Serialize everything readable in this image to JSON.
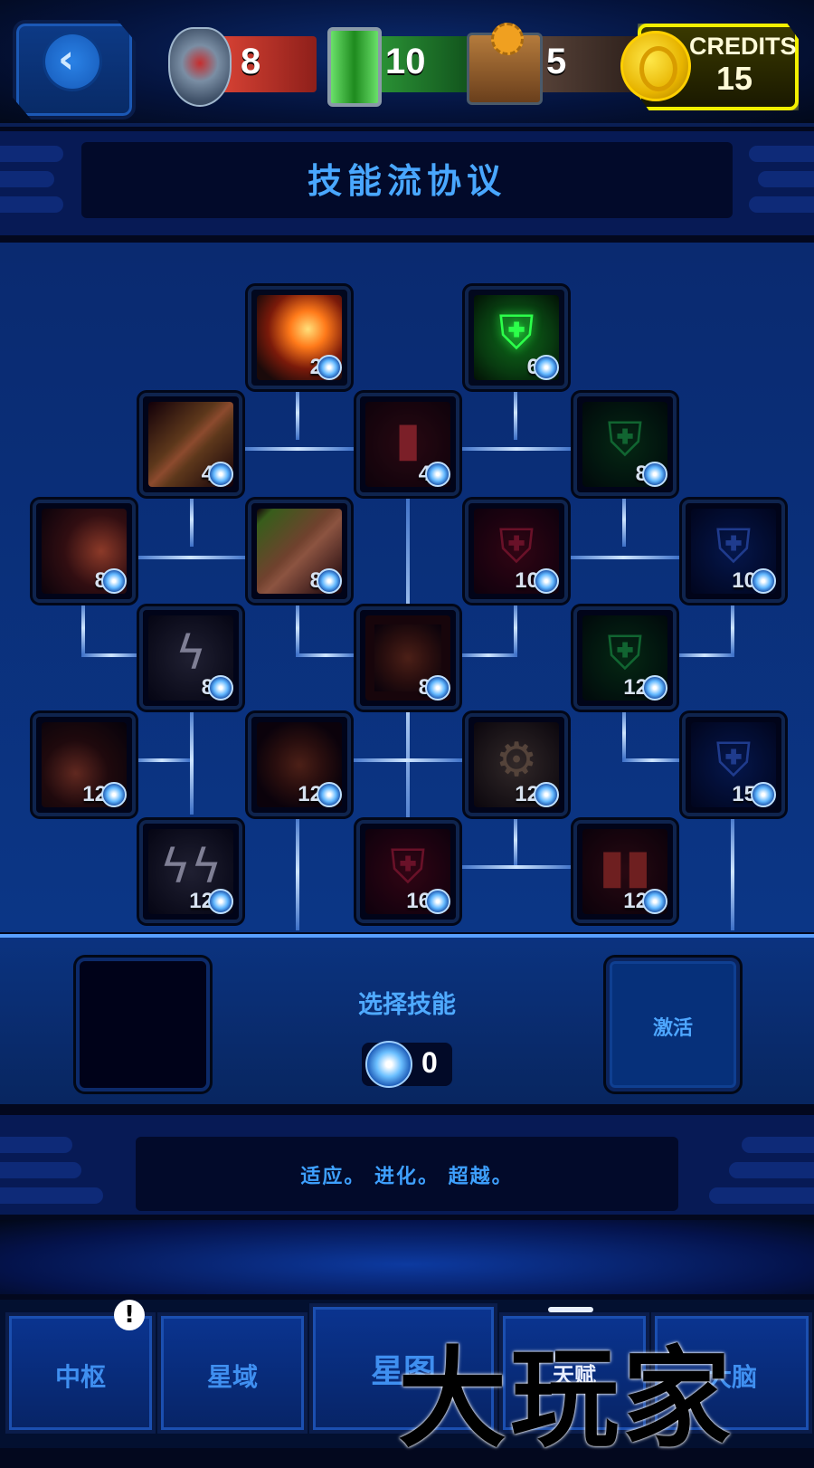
{
  "resources": {
    "health": {
      "value": "8",
      "icon": "mechanical-heart-icon",
      "color": "#c0392b"
    },
    "energy": {
      "value": "10",
      "icon": "battery-icon",
      "color": "#2e7d32"
    },
    "parts": {
      "value": "5",
      "icon": "gear-chest-icon",
      "color": "#5a3b2e"
    },
    "credits": {
      "label": "CREDITS",
      "value": "15",
      "color": "#f3f000"
    }
  },
  "header": {
    "title": "技能流协议"
  },
  "skills": [
    {
      "name": "cannon-blast",
      "cost": "2",
      "icon": "cannon-fire-icon"
    },
    {
      "name": "shield-heal",
      "cost": "6",
      "icon": "green-shield-plus-icon"
    },
    {
      "name": "laser-beam",
      "cost": "4",
      "icon": "red-laser-icon"
    },
    {
      "name": "battery-heal",
      "cost": "4",
      "icon": "battery-plus-icon"
    },
    {
      "name": "shield-heal-2",
      "cost": "8",
      "icon": "green-shield-double-plus-icon"
    },
    {
      "name": "heart-cannon",
      "cost": "8",
      "icon": "heart-cannon-icon"
    },
    {
      "name": "laser-spray",
      "cost": "8",
      "icon": "laser-spray-icon"
    },
    {
      "name": "red-shield",
      "cost": "10",
      "icon": "red-shield-plus-icon"
    },
    {
      "name": "blue-shield",
      "cost": "10",
      "icon": "blue-shield-plus-icon"
    },
    {
      "name": "lightning",
      "cost": "8",
      "icon": "lightning-icon"
    },
    {
      "name": "heart-engine",
      "cost": "8",
      "icon": "heart-engine-plus-icon"
    },
    {
      "name": "shield-heal-3",
      "cost": "12",
      "icon": "green-shield-triple-plus-icon"
    },
    {
      "name": "laser-turret",
      "cost": "12",
      "icon": "laser-turret-icon"
    },
    {
      "name": "heart-engine-2",
      "cost": "12",
      "icon": "heart-engine-plus-icon"
    },
    {
      "name": "gears",
      "cost": "12",
      "icon": "gears-icon"
    },
    {
      "name": "blue-shield-2",
      "cost": "15",
      "icon": "blue-shield-double-plus-icon"
    },
    {
      "name": "double-lightning",
      "cost": "12",
      "icon": "double-lightning-icon"
    },
    {
      "name": "red-shield-2",
      "cost": "16",
      "icon": "red-shield-double-plus-icon"
    },
    {
      "name": "double-battery",
      "cost": "12",
      "icon": "double-battery-icon"
    }
  ],
  "selection": {
    "label": "选择技能",
    "points": "0",
    "activate_label": "激活"
  },
  "slogan": "适应。 进化。 超越。",
  "tabs": [
    {
      "label": "中枢",
      "badge": "!"
    },
    {
      "label": "星域"
    },
    {
      "label": "星图"
    },
    {
      "label": "天赋"
    },
    {
      "label": "大脑"
    }
  ],
  "watermark": "大玩家"
}
